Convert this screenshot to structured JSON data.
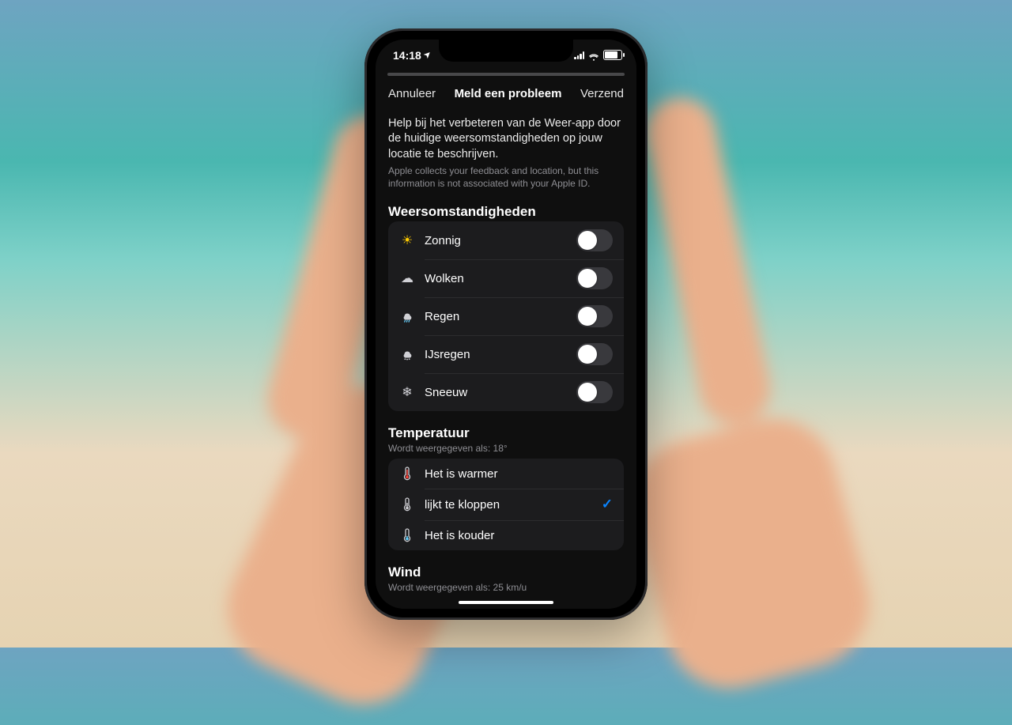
{
  "status": {
    "time": "14:18",
    "location_arrow": "➤"
  },
  "nav": {
    "cancel": "Annuleer",
    "title": "Meld een probleem",
    "send": "Verzend"
  },
  "intro": {
    "main": "Help bij het verbeteren van de Weer-app door de huidige weersomstandigheden op jouw locatie te beschrijven.",
    "sub": "Apple collects your feedback and location, but this information is not associated with your Apple ID."
  },
  "sections": {
    "conditions": {
      "header": "Weersomstandigheden",
      "items": [
        {
          "icon": "sun",
          "label": "Zonnig",
          "on": false
        },
        {
          "icon": "cloud",
          "label": "Wolken",
          "on": false
        },
        {
          "icon": "rain",
          "label": "Regen",
          "on": false
        },
        {
          "icon": "sleet",
          "label": "IJsregen",
          "on": false
        },
        {
          "icon": "snow",
          "label": "Sneeuw",
          "on": false
        }
      ]
    },
    "temperature": {
      "header": "Temperatuur",
      "sub": "Wordt weergegeven als: 18°",
      "items": [
        {
          "icon": "therm-hot",
          "label": "Het is warmer",
          "selected": false
        },
        {
          "icon": "therm-mid",
          "label": "lijkt te kloppen",
          "selected": true
        },
        {
          "icon": "therm-cold",
          "label": "Het is kouder",
          "selected": false
        }
      ]
    },
    "wind": {
      "header": "Wind",
      "sub": "Wordt weergegeven als: 25 km/u"
    }
  }
}
